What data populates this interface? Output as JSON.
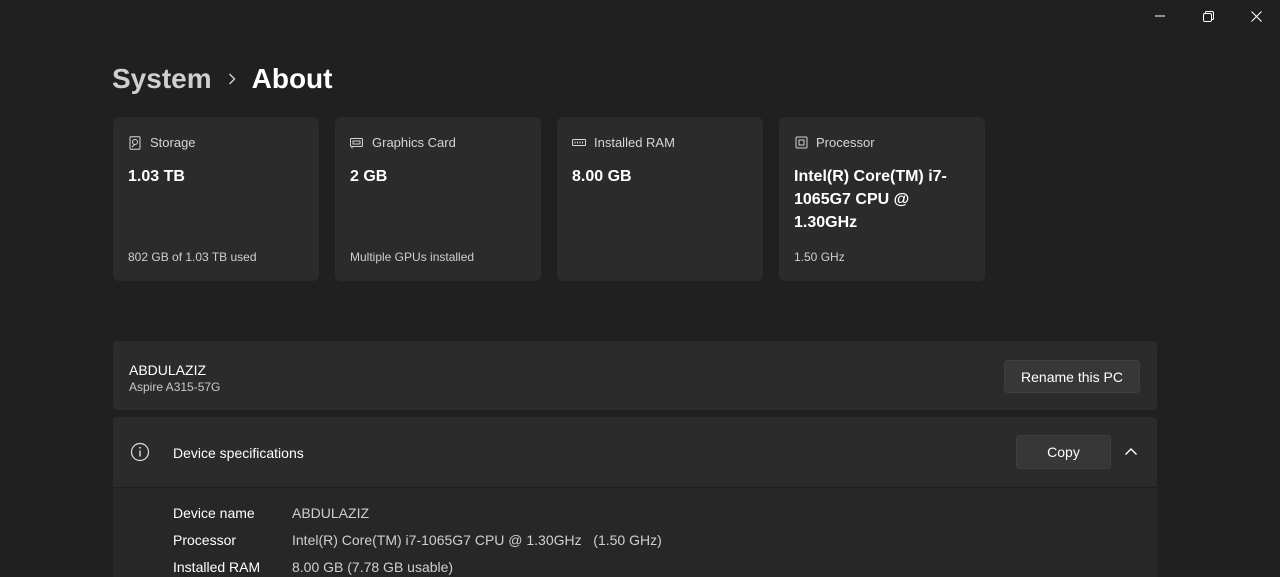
{
  "window": {
    "controls": {
      "minimize": "minimize-icon",
      "maximize": "restore-icon",
      "close": "close-icon"
    }
  },
  "breadcrumb": {
    "parent": "System",
    "separator_icon": "chevron-right-icon",
    "current": "About"
  },
  "cards": [
    {
      "icon": "storage-icon",
      "label": "Storage",
      "value": "1.03 TB",
      "sub": "802 GB of 1.03 TB used"
    },
    {
      "icon": "graphics-card-icon",
      "label": "Graphics Card",
      "value": "2 GB",
      "sub": "Multiple GPUs installed"
    },
    {
      "icon": "ram-icon",
      "label": "Installed RAM",
      "value": "8.00 GB",
      "sub": ""
    },
    {
      "icon": "processor-icon",
      "label": "Processor",
      "value": "Intel(R) Core(TM) i7-1065G7 CPU @ 1.30GHz",
      "sub": "1.50 GHz"
    }
  ],
  "pc": {
    "name": "ABDULAZIZ",
    "model": "Aspire A315-57G",
    "rename_label": "Rename this PC"
  },
  "device_specs": {
    "title": "Device specifications",
    "copy_label": "Copy",
    "rows": [
      {
        "label": "Device name",
        "value": "ABDULAZIZ"
      },
      {
        "label": "Processor",
        "value": "Intel(R) Core(TM) i7-1065G7 CPU @ 1.30GHz   (1.50 GHz)"
      },
      {
        "label": "Installed RAM",
        "value": "8.00 GB (7.78 GB usable)"
      }
    ]
  },
  "colors": {
    "background": "#202020",
    "card": "#2b2b2b",
    "button": "#373737"
  }
}
